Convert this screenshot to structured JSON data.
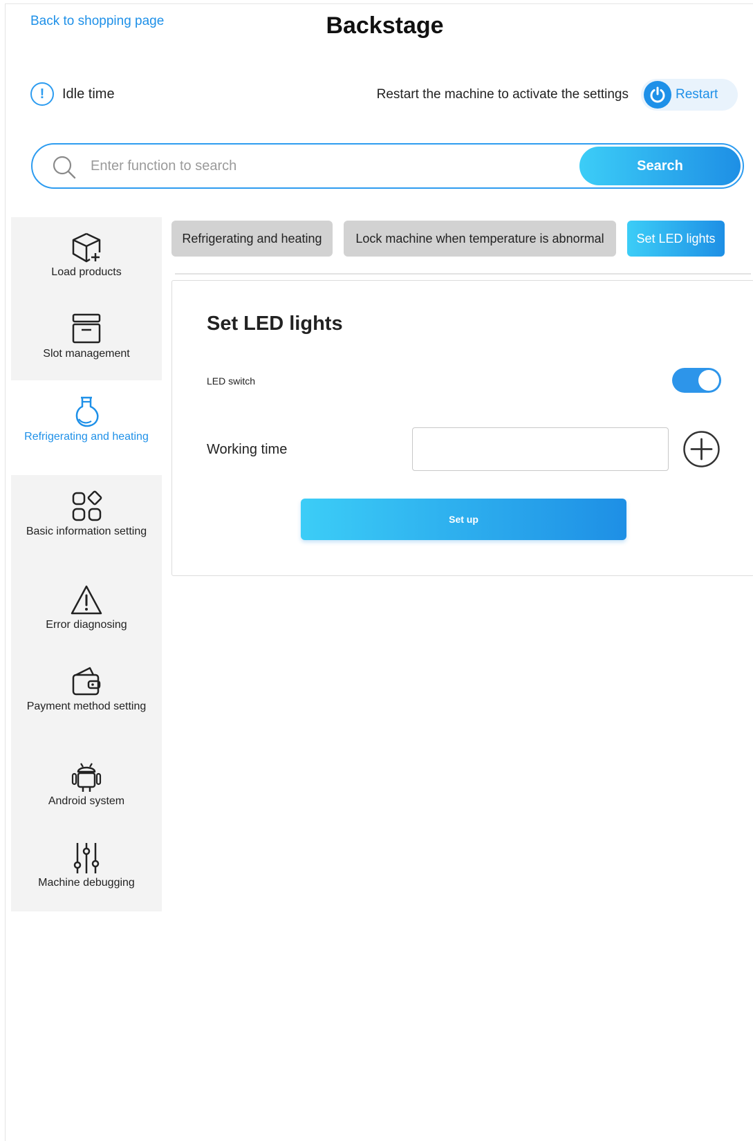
{
  "header": {
    "back_link": "Back to shopping page",
    "title": "Backstage"
  },
  "status": {
    "idle_icon": "exclamation-circle-icon",
    "idle_label": "Idle time",
    "restart_hint": "Restart the machine to activate the settings",
    "restart_label": "Restart"
  },
  "search": {
    "placeholder": "Enter function to search",
    "value": "",
    "button_label": "Search"
  },
  "sidebar": {
    "items": [
      {
        "label": "Load products",
        "icon": "box-add-icon",
        "active": false
      },
      {
        "label": "Slot management",
        "icon": "archive-box-icon",
        "active": false
      },
      {
        "label": "Refrigerating and heating",
        "icon": "bulb-refrigerate-icon",
        "active": true
      },
      {
        "label": "Basic information setting",
        "icon": "apps-grid-icon",
        "active": false
      },
      {
        "label": "Error diagnosing",
        "icon": "warning-triangle-icon",
        "active": false
      },
      {
        "label": "Payment method setting",
        "icon": "wallet-icon",
        "active": false
      },
      {
        "label": "Android system",
        "icon": "android-icon",
        "active": false
      },
      {
        "label": "Machine debugging",
        "icon": "sliders-icon",
        "active": false
      }
    ]
  },
  "tabs": [
    {
      "label": "Refrigerating and heating",
      "active": false
    },
    {
      "label": "Lock machine when temperature is abnormal",
      "active": false
    },
    {
      "label": "Set LED lights",
      "active": true
    }
  ],
  "panel": {
    "title": "Set LED lights",
    "led_switch_label": "LED switch",
    "led_switch_on": true,
    "working_time_label": "Working time",
    "working_time_value": "",
    "setup_label": "Set up"
  },
  "colors": {
    "accent": "#1e90e8",
    "gradient_start": "#3ccdf7",
    "gradient_end": "#1e8fe5",
    "tab_inactive": "#d2d2d2",
    "sidebar_bg": "#f3f3f3"
  }
}
